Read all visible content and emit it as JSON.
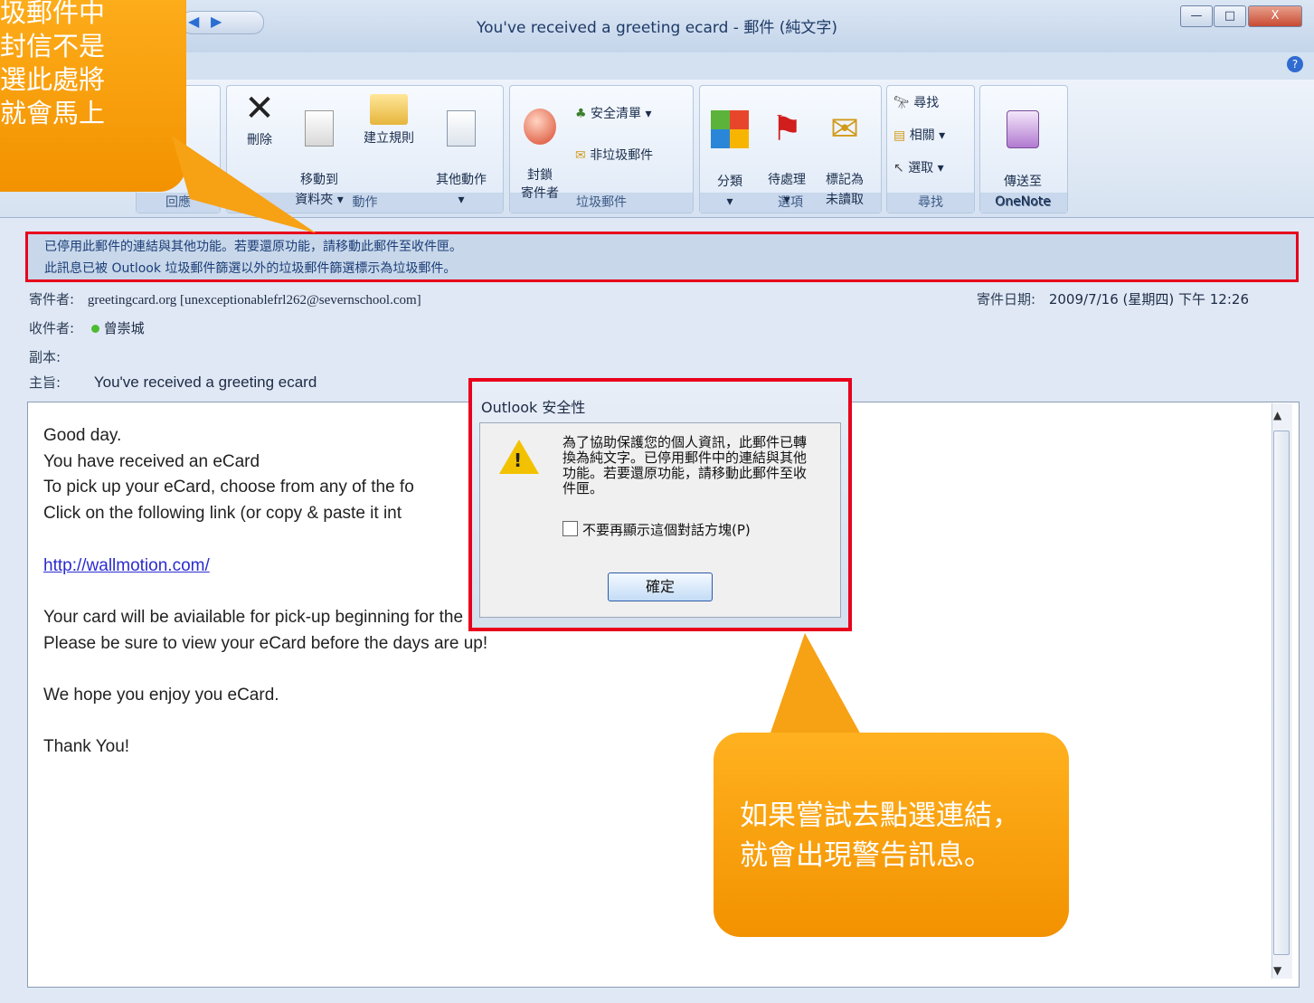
{
  "window": {
    "title": "You've received a greeting ecard  - 郵件 (純文字)",
    "min_label": "—",
    "max_label": "□",
    "close_label": "X"
  },
  "ribbon": {
    "groups": [
      {
        "label": "回應"
      },
      {
        "label": "動作",
        "buttons": [
          "刪除",
          "移動到\n資料夾 ▾",
          "建立規則",
          "其他動作\n▾"
        ]
      },
      {
        "label": "垃圾郵件",
        "buttons": [
          "封鎖\n寄件者"
        ],
        "small": [
          "安全清單 ▾",
          "非垃圾郵件"
        ]
      },
      {
        "label": "選項",
        "buttons": [
          "分類\n▾",
          "待處理\n▾",
          "標記為\n未讀取"
        ]
      },
      {
        "label": "尋找",
        "small": [
          "尋找",
          "相關 ▾",
          "選取 ▾"
        ]
      },
      {
        "label": "OneNote",
        "buttons": [
          "傳送至\nOneNote"
        ]
      }
    ]
  },
  "infobar": {
    "line1": "已停用此郵件的連結與其他功能。若要還原功能，請移動此郵件至收件匣。",
    "line2": "此訊息已被 Outlook 垃圾郵件篩選以外的垃圾郵件篩選標示為垃圾郵件。"
  },
  "header": {
    "from_label": "寄件者:",
    "from_value": "greetingcard.org [unexceptionablefrl262@severnschool.com]",
    "sent_label": "寄件日期:",
    "sent_value": "2009/7/16 (星期四) 下午 12:26",
    "to_label": "收件者:",
    "to_value": "曾崇城",
    "cc_label": "副本:",
    "subject_label": "主旨:",
    "subject_value": "You've received a greeting ecard"
  },
  "body": {
    "lines": [
      "Good day.",
      "You have received an eCard",
      "",
      "To pick up your eCard, choose from any of the fo",
      "Click on the following link (or copy & paste it int",
      "",
      "http://wallmotion.com/",
      "",
      "Your card will be aviailable for pick-up beginning for the next 30 days.",
      "Please be sure to view your eCard before the days are up!",
      "",
      "We hope you enjoy you eCard.",
      "",
      "Thank You!"
    ]
  },
  "dialog": {
    "title": "Outlook 安全性",
    "message": "為了協助保護您的個人資訊，此郵件已轉換為純文字。已停用郵件中的連結與其他功能。若要還原功能，請移動此郵件至收件匣。",
    "checkbox_label": "不要再顯示這個對話方塊(P)",
    "ok_label": "確定"
  },
  "callouts": {
    "top_left": "圾郵件中\n封信不是\n選此處將\n就會馬上",
    "bottom": "如果嘗試去點選連結，\n就會出現警告訊息。"
  },
  "colors": {
    "highlight_red": "#e8001c",
    "callout_orange": "#f7a114",
    "link_blue": "#2b2bd0"
  }
}
